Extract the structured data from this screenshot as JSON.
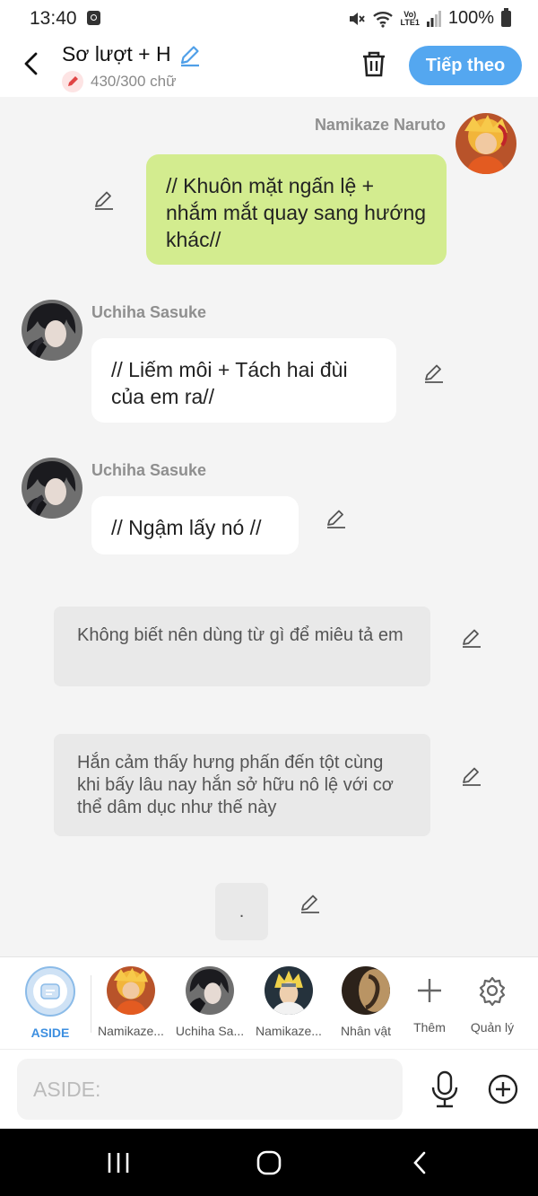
{
  "status_bar": {
    "time": "13:40",
    "battery": "100%",
    "volte": "Vo) LTE1"
  },
  "header": {
    "title": "Sơ lượt + H",
    "counter": "430/300 chữ",
    "next_label": "Tiếp theo"
  },
  "messages": [
    {
      "type": "me",
      "sender": "Namikaze Naruto",
      "text": "// Khuôn mặt ngấn lệ + nhắm mắt quay sang hướng khác//"
    },
    {
      "type": "them",
      "sender": "Uchiha Sasuke",
      "text": "// Liếm môi + Tách hai đùi của em ra//"
    },
    {
      "type": "them",
      "sender": "Uchiha Sasuke",
      "text": "// Ngậm lấy nó //"
    },
    {
      "type": "aside",
      "text": "Không biết nên dùng từ gì để miêu tả em"
    },
    {
      "type": "aside",
      "text": "Hắn cảm thấy hưng phấn đến tột cùng khi bấy lâu nay hắn sở hữu nô lệ với cơ thể dâm dục như thế này"
    },
    {
      "type": "aside",
      "text": "."
    }
  ],
  "characters": [
    {
      "label": "ASIDE",
      "selected": true
    },
    {
      "label": "Namikaze..."
    },
    {
      "label": "Uchiha Sa..."
    },
    {
      "label": "Namikaze..."
    },
    {
      "label": "Nhân vật"
    }
  ],
  "tools": {
    "add_label": "Thêm",
    "manage_label": "Quản lý"
  },
  "input": {
    "placeholder": "ASIDE:"
  },
  "colors": {
    "accent": "#54a7f0",
    "my_bubble": "#d3ec8f",
    "their_bubble": "#ffffff",
    "aside_bubble": "#e9e9e9"
  },
  "icons": [
    "back-icon",
    "pencil-icon",
    "trash-icon",
    "microphone-icon",
    "plus-circle-icon",
    "gear-icon",
    "plus-icon",
    "recents-icon",
    "home-icon",
    "nav-back-icon"
  ]
}
